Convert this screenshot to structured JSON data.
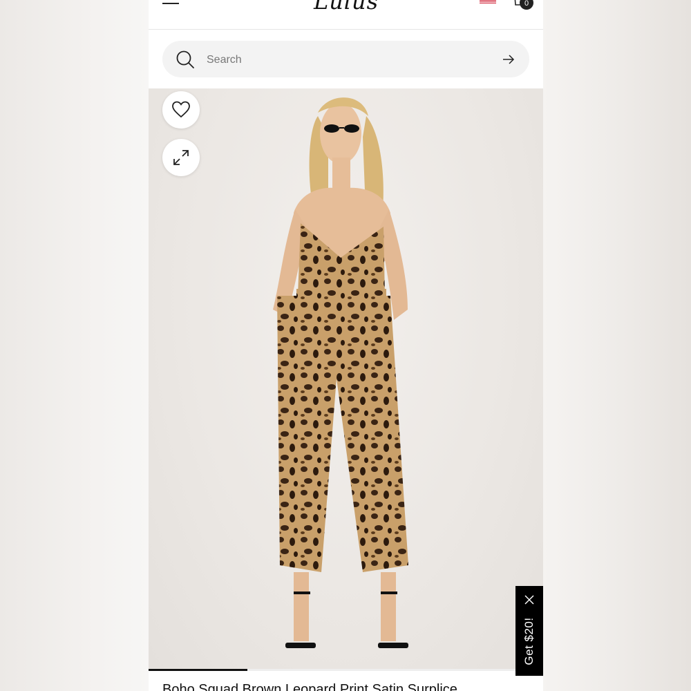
{
  "header": {
    "logo_text": "Lulus",
    "cart_count": "0"
  },
  "search": {
    "placeholder": "Search"
  },
  "gallery": {
    "progress": 0.25
  },
  "product": {
    "title": "Boho Squad Brown Leopard Print Satin Surplice"
  },
  "promo": {
    "label": "Get $20!"
  },
  "icons": [
    "menu-icon",
    "flag-icon",
    "cart-icon",
    "search-icon",
    "arrow-right-icon",
    "heart-icon",
    "expand-icon",
    "close-icon"
  ],
  "colors": {
    "accent": "#111111",
    "search_bg": "#f3f3f3",
    "promo_bg": "#000000"
  }
}
